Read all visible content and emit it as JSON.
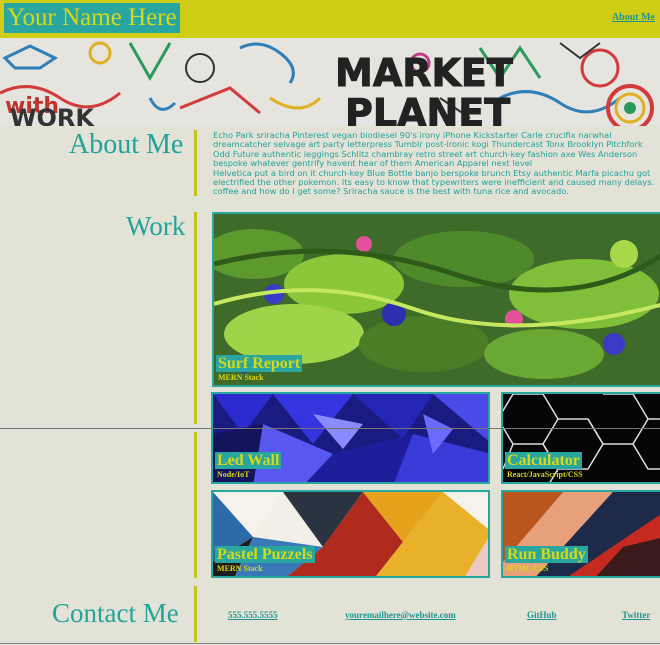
{
  "header": {
    "site_title": "Your Name Here",
    "nav_about": "About Me"
  },
  "hero": {
    "graffiti_line1": "MARKET",
    "graffiti_line2": "PLANET",
    "graffiti_left1": "with",
    "graffiti_left2": "WORK"
  },
  "about": {
    "title": "About Me",
    "paragraph1": "Echo Park sriracha Pinterest vegan biodiesel 90's irony iPhone Kickstarter Carle crucifix narwhal dreamcatcher selvage art party letterpress Tumblr post-ironic kogi Thundercast Tonx Brooklyn Pitchfork Odd Future authentic leggings Schlitz chambray retro street art church-key fashion axe Wes Anderson bespoke whatever gentrify havent hear of them American Apparel next level",
    "paragraph2": "Helvetica put a bird on it church-key Blue Bottle banjo berspoke brunch Etsy authentic Marfa picachu got electrified the other pokemon. Its easy to know that typewriters were inefficient and caused many delays. coffee and how do I get some? Sriracha sauce is the best with tuna rice and avocado."
  },
  "work": {
    "title": "Work",
    "projects": [
      {
        "name": "Surf Report",
        "tech": "MERN Stack"
      },
      {
        "name": "Led Wall",
        "tech": "Node/IoT"
      },
      {
        "name": "Calculator",
        "tech": "React/JavaScript/CSS"
      },
      {
        "name": "Pastel Puzzels",
        "tech": "MERN Stack"
      },
      {
        "name": "Run Buddy",
        "tech": "HTML/CSS"
      }
    ]
  },
  "contact": {
    "title": "Contact Me",
    "phone": "555.555.5555",
    "email": "youremailhere@website.com",
    "github": "GitHub",
    "twitter": "Twitter"
  },
  "colors": {
    "accent_yellow": "#cfcd16",
    "accent_teal": "#2aa6a0",
    "background": "#e2e3d6"
  }
}
